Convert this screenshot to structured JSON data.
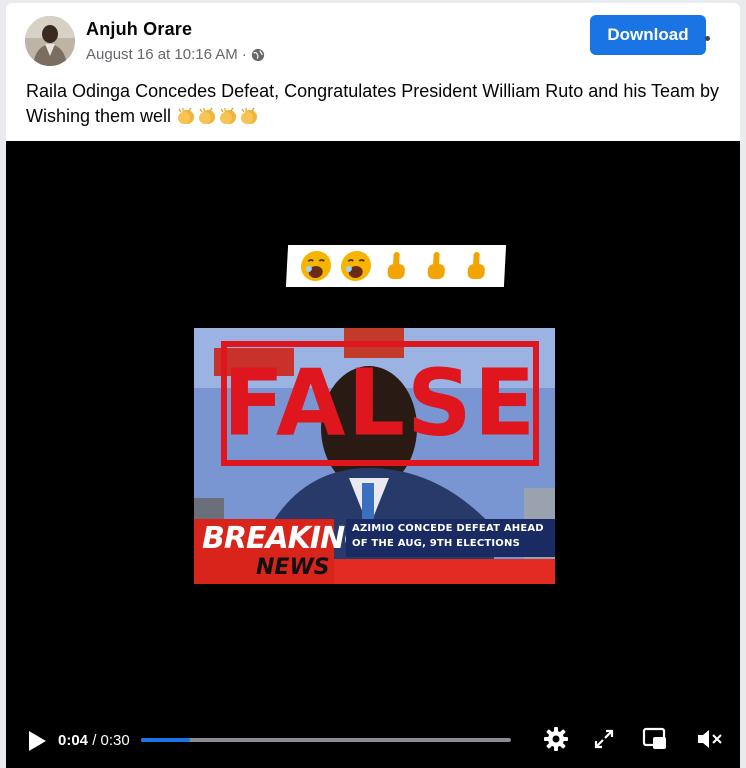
{
  "post": {
    "author": "Anjuh Orare",
    "timestamp": "August 16 at 10:16 AM",
    "separator": "·",
    "privacy_icon": "globe-icon",
    "caption": "Raila Odinga Concedes Defeat, Congratulates President William Ruto and his Team by Wishing them well",
    "caption_emojis": [
      "clapping-hands",
      "clapping-hands",
      "clapping-hands",
      "clapping-hands"
    ]
  },
  "actions": {
    "download_label": "Download"
  },
  "video": {
    "emoji_strip": [
      "yawning-face",
      "yawning-face",
      "index-pointing-up",
      "index-pointing-up",
      "index-pointing-up"
    ],
    "stamp_text": "FALSE",
    "breaking_label": "BREAKING",
    "news_label": "NEWS",
    "overlay_headline": "AZIMIO CONCEDE DEFEAT AHEAD OF THE AUG, 9TH ELECTIONS",
    "current_time": "0:04",
    "time_separator": "/",
    "duration": "0:30",
    "progress_fraction": 0.1333,
    "controls": [
      "play-icon",
      "settings-icon",
      "fullscreen-icon",
      "picture-in-picture-icon",
      "volume-muted-icon"
    ]
  },
  "colors": {
    "accent": "#1b74e4",
    "stamp_red": "#e0161e"
  }
}
